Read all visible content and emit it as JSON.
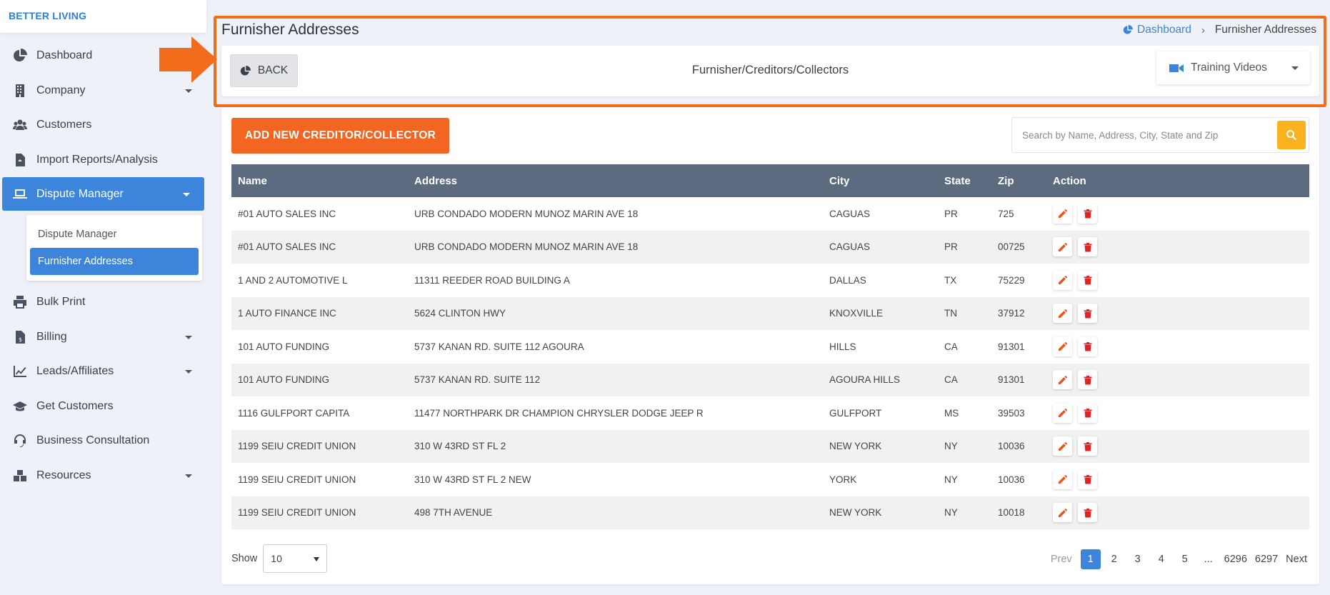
{
  "brand": "BETTER LIVING",
  "sidebar": {
    "items": [
      {
        "label": "Dashboard",
        "icon": "pie-chart-icon"
      },
      {
        "label": "Company",
        "icon": "building-icon",
        "has_caret": true
      },
      {
        "label": "Customers",
        "icon": "users-icon"
      },
      {
        "label": "Import Reports/Analysis",
        "icon": "file-import-icon"
      },
      {
        "label": "Dispute Manager",
        "icon": "laptop-icon",
        "has_caret": true,
        "active": true
      },
      {
        "label": "Bulk Print",
        "icon": "print-icon"
      },
      {
        "label": "Billing",
        "icon": "invoice-icon",
        "has_caret": true
      },
      {
        "label": "Leads/Affiliates",
        "icon": "line-chart-icon",
        "has_caret": true
      },
      {
        "label": "Get Customers",
        "icon": "graduation-cap-icon"
      },
      {
        "label": "Business Consultation",
        "icon": "headset-icon"
      },
      {
        "label": "Resources",
        "icon": "boxes-icon",
        "has_caret": true
      }
    ],
    "submenu": [
      {
        "label": "Dispute Manager"
      },
      {
        "label": "Furnisher Addresses",
        "active": true
      }
    ]
  },
  "header": {
    "title": "Furnisher Addresses",
    "breadcrumb": {
      "home": "Dashboard",
      "current": "Furnisher Addresses"
    }
  },
  "toolbar": {
    "back_label": "BACK",
    "center_label": "Furnisher/Creditors/Collectors",
    "training_label": "Training Videos"
  },
  "actions": {
    "add_label": "ADD NEW CREDITOR/COLLECTOR",
    "search_placeholder": "Search by Name, Address, City, State and Zip"
  },
  "table": {
    "columns": [
      "Name",
      "Address",
      "City",
      "State",
      "Zip",
      "Action"
    ],
    "rows": [
      [
        "#01 AUTO SALES INC",
        "URB CONDADO MODERN MUNOZ MARIN AVE 18",
        "CAGUAS",
        "PR",
        "725"
      ],
      [
        "#01 AUTO SALES INC",
        "URB CONDADO MODERN MUNOZ MARIN AVE 18",
        "CAGUAS",
        "PR",
        "00725"
      ],
      [
        "1 AND 2 AUTOMOTIVE L",
        "11311 REEDER ROAD BUILDING A",
        "DALLAS",
        "TX",
        "75229"
      ],
      [
        "1 AUTO FINANCE INC",
        "5624 CLINTON HWY",
        "KNOXVILLE",
        "TN",
        "37912"
      ],
      [
        "101 AUTO FUNDING",
        "5737 KANAN RD. SUITE 112 AGOURA",
        "HILLS",
        "CA",
        "91301"
      ],
      [
        "101 AUTO FUNDING",
        "5737 KANAN RD. SUITE 112",
        "AGOURA HILLS",
        "CA",
        "91301"
      ],
      [
        "1116 GULFPORT CAPITA",
        "11477 NORTHPARK DR CHAMPION CHRYSLER DODGE JEEP R",
        "GULFPORT",
        "MS",
        "39503"
      ],
      [
        "1199 SEIU CREDIT UNION",
        "310 W 43RD ST FL 2",
        "NEW YORK",
        "NY",
        "10036"
      ],
      [
        "1199 SEIU CREDIT UNION",
        "310 W 43RD ST FL 2 NEW",
        "YORK",
        "NY",
        "10036"
      ],
      [
        "1199 SEIU CREDIT UNION",
        "498 7TH AVENUE",
        "NEW YORK",
        "NY",
        "10018"
      ]
    ]
  },
  "footer": {
    "show_label": "Show",
    "page_size": "10",
    "pagination": {
      "prev": "Prev",
      "pages": [
        "1",
        "2",
        "3",
        "4",
        "5",
        "...",
        "6296",
        "6297"
      ],
      "current": "1",
      "next": "Next"
    }
  },
  "colors": {
    "accent_blue": "#3d85db",
    "orange": "#f26522",
    "highlight_border": "#f26d1b",
    "table_header": "#5d6b80",
    "search_button": "#fbb21f",
    "edit_icon": "#e8561f",
    "delete_icon": "#e02424"
  }
}
